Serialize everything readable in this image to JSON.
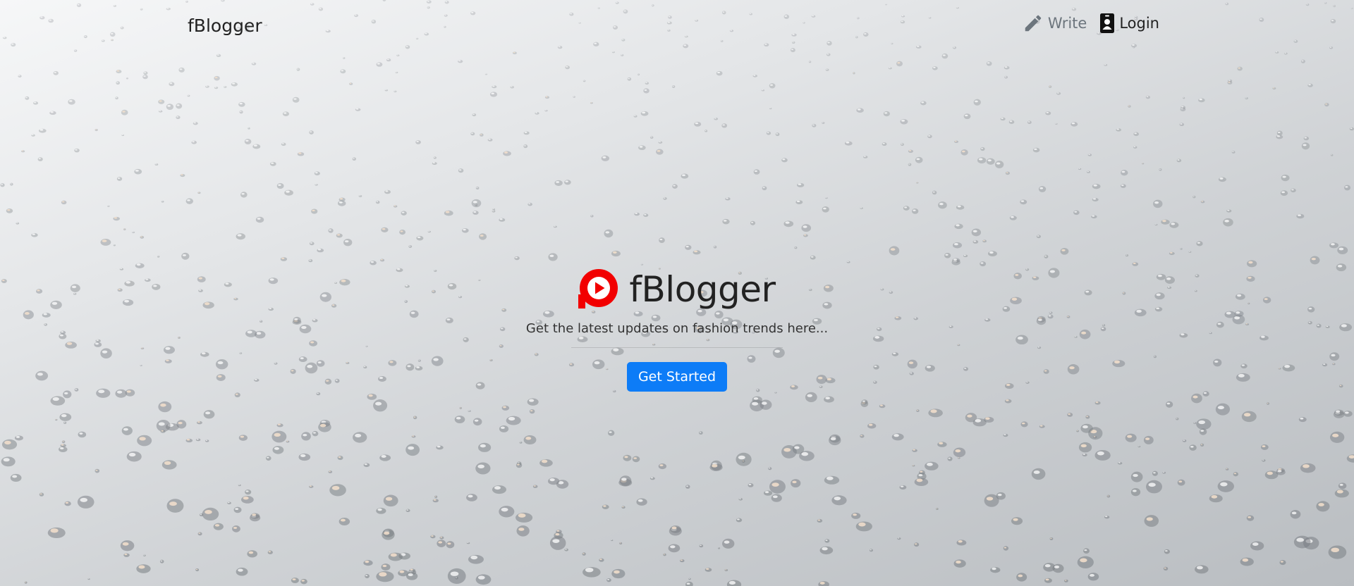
{
  "nav": {
    "brand": "fBlogger",
    "links": [
      {
        "label": "Write",
        "icon": "pencil-icon"
      },
      {
        "label": "Login",
        "icon": "id-badge-icon"
      }
    ]
  },
  "hero": {
    "logo_icon": "play-circle-icon",
    "title": "fBlogger",
    "tagline": "Get the latest updates on fashion trends here...",
    "cta_label": "Get Started"
  },
  "colors": {
    "logo": "#f20000",
    "button": "#0d7cf7",
    "nav_muted": "#6c757d",
    "text": "#222222"
  }
}
